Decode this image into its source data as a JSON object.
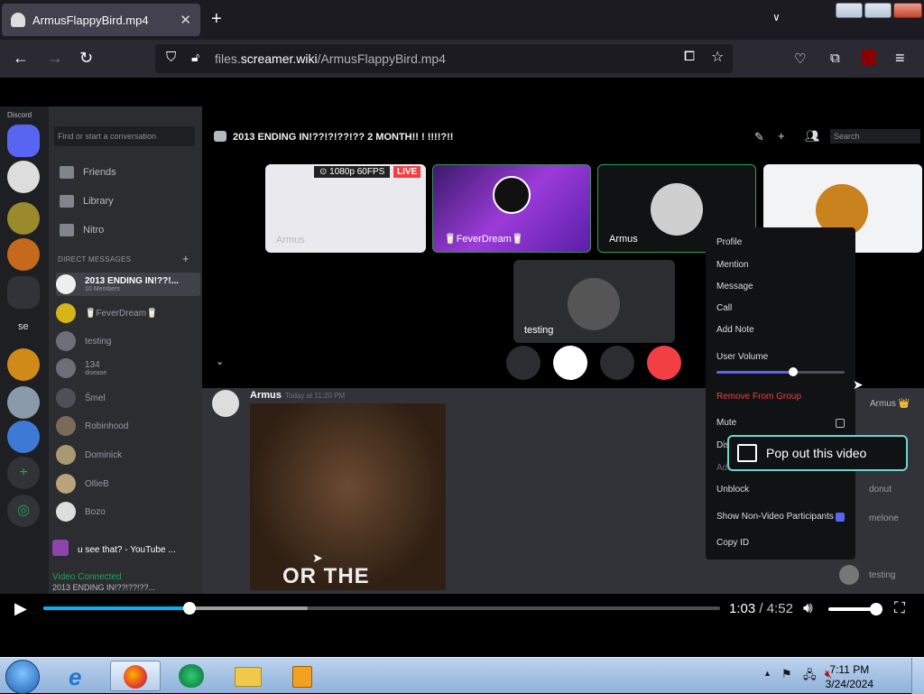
{
  "browser": {
    "tab_title": "ArmusFlappyBird.mp4",
    "url_domain": "files.",
    "url_host": "screamer.wiki",
    "url_path": "/ArmusFlappyBird.mp4"
  },
  "discord": {
    "brand": "Discord",
    "search_placeholder": "Find or start a conversation",
    "nav": [
      "Friends",
      "Library",
      "Nitro"
    ],
    "dm_header": "DIRECT MESSAGES",
    "dms": [
      {
        "name": "2013 ENDING IN!??!...",
        "sub": "10 Members"
      },
      {
        "name": "🥛FeverDream🥛",
        "sub": ""
      },
      {
        "name": "testing",
        "sub": ""
      },
      {
        "name": "134",
        "sub": "disease"
      },
      {
        "name": "Šmel",
        "sub": ""
      },
      {
        "name": "Robinhood",
        "sub": ""
      },
      {
        "name": "Dominick",
        "sub": ""
      },
      {
        "name": "OllieB",
        "sub": ""
      },
      {
        "name": "Bozo",
        "sub": ""
      }
    ],
    "activity_text": "u see that? - YouTube ...",
    "voice_status": "Video Connected",
    "voice_channel": "2013 ENDING IN!??!??!??...",
    "call_title": "2013 ENDING IN!??!?!??!?? 2 MONTH!! ! !!!!?!!",
    "call_search_placeholder": "Search",
    "stream_badge": "⊙ 1080p 60FPS",
    "live_badge": "LIVE",
    "tiles": [
      "Armus",
      "🥛FeverDream🥛",
      "Armus",
      "",
      "testing"
    ],
    "chat_author": "Armus",
    "chat_time": "Today at 11:20 PM",
    "meme_caption": "OR THE GHETTO",
    "members": [
      "Armus 👑",
      "donut",
      "melone",
      "testing"
    ],
    "context_menu": {
      "items": [
        "Profile",
        "Mention",
        "Message",
        "Call",
        "Add Note"
      ],
      "volume_label": "User Volume",
      "volume_level": 0.6,
      "remove": "Remove From Group",
      "mute": "Mute",
      "disable_video": "Dis",
      "add_friend": "Add",
      "unblock": "Unblock",
      "show_non_video": "Show Non-Video Participants",
      "copy_id": "Copy ID"
    },
    "popout_tooltip": "Pop out this video"
  },
  "player": {
    "current_time": "1:03",
    "separator": " / ",
    "duration": "4:52",
    "progress": 0.216,
    "buffered": 0.39,
    "volume": 0.95
  },
  "taskbar": {
    "time": "7:11 PM",
    "date": "3/24/2024"
  }
}
